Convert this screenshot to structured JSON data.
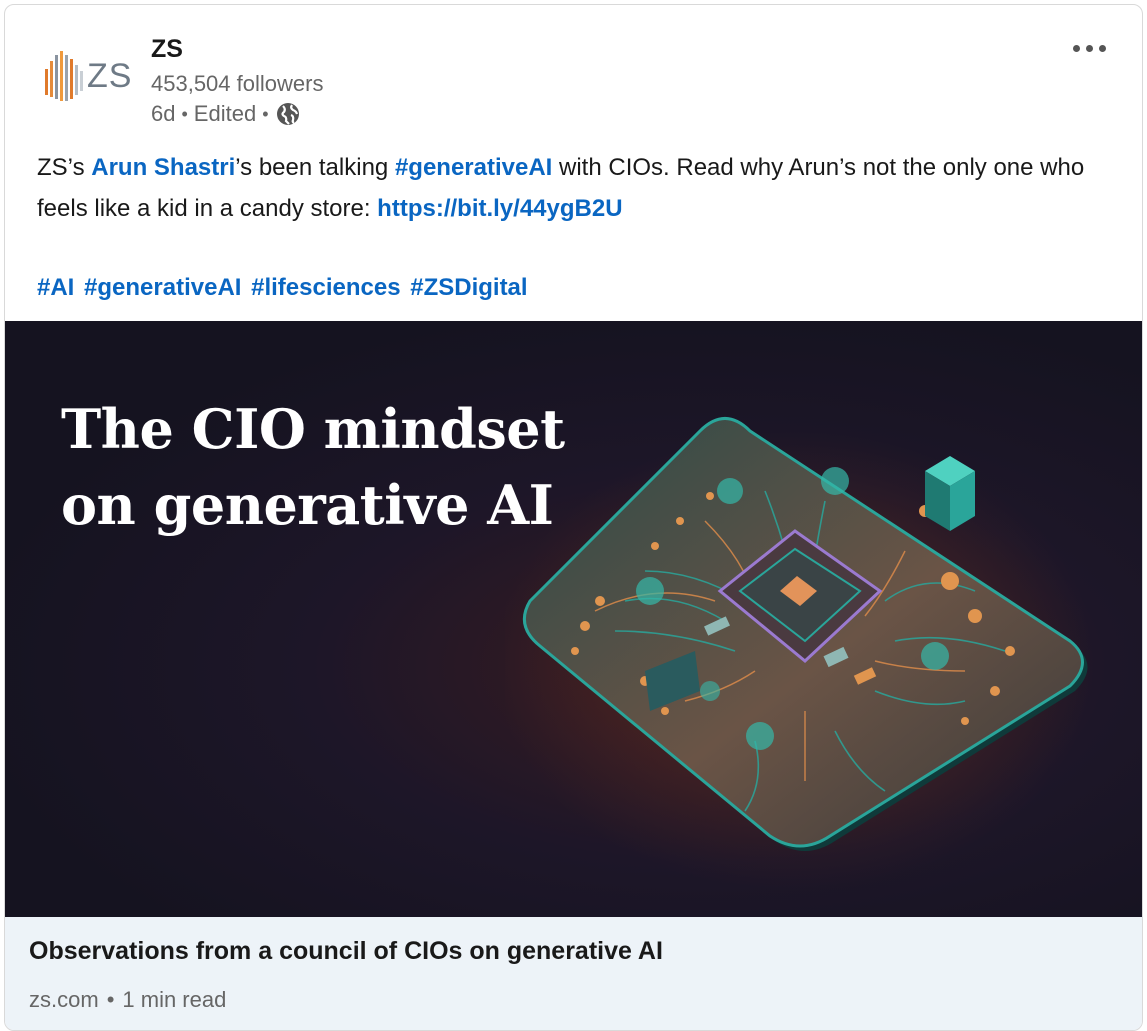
{
  "post": {
    "company": "ZS",
    "logo_text": "ZS",
    "followers": "453,504 followers",
    "age": "6d",
    "edited": "Edited",
    "separator": "•",
    "more_icon": "ellipsis-icon",
    "visibility_icon": "globe-icon",
    "text": {
      "part1": "ZS’s ",
      "mention": "Arun Shastri",
      "part2": "’s been talking ",
      "hashtag1": "#generativeAI",
      "part3": " with CIOs. Read why Arun’s not the only one who feels like a kid in a candy store: ",
      "url": "https://bit.ly/44ygB2U"
    },
    "hashtags": [
      "#AI",
      "#generativeAI",
      "#lifesciences",
      "#ZSDigital"
    ]
  },
  "media": {
    "title_line1": "The CIO mindset",
    "title_line2": "on generative AI"
  },
  "article": {
    "title": "Observations from a council of CIOs on generative AI",
    "domain": "zs.com",
    "separator": "•",
    "read_time": "1 min read"
  },
  "colors": {
    "link": "#0a66c2",
    "footer_bg": "#edf3f8",
    "media_bg": "#151320",
    "teal": "#2aa59a",
    "copper": "#d98a4a"
  }
}
